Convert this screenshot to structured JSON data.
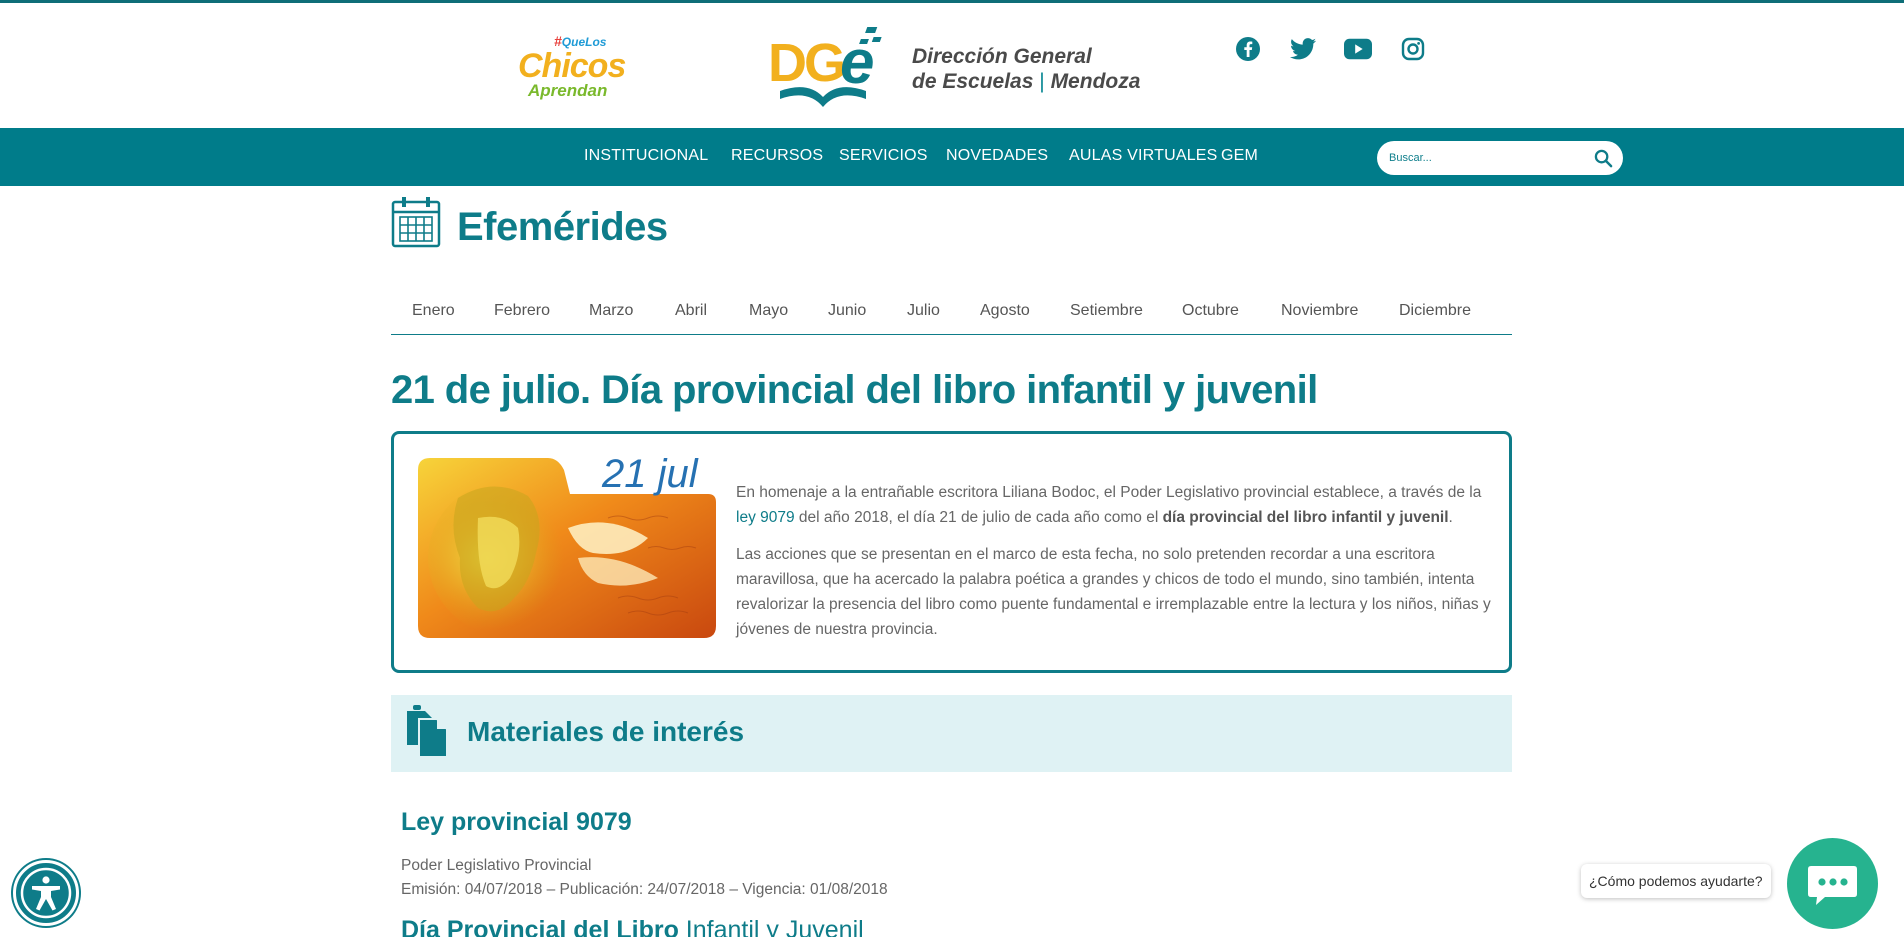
{
  "header": {
    "campaign": {
      "hash": "#",
      "que_los": "QueLos",
      "chicos": "Chicos",
      "aprendan": "Aprendan"
    },
    "logo_mark": "DGe",
    "org_line1": "Dirección General",
    "org_line2a": "de Escuelas",
    "org_sep": "|",
    "org_line2b": "Mendoza",
    "social": [
      "facebook-icon",
      "twitter-icon",
      "youtube-icon",
      "instagram-icon"
    ]
  },
  "nav": {
    "items": [
      "INSTITUCIONAL",
      "RECURSOS",
      "SERVICIOS",
      "NOVEDADES",
      "AULAS VIRTUALES",
      "GEM"
    ],
    "search_placeholder": "Buscar..."
  },
  "page": {
    "title": "Efemérides",
    "months": [
      "Enero",
      "Febrero",
      "Marzo",
      "Abril",
      "Mayo",
      "Junio",
      "Julio",
      "Agosto",
      "Setiembre",
      "Octubre",
      "Noviembre",
      "Diciembre"
    ],
    "headline": "21 de julio. Día provincial del libro infantil y juvenil"
  },
  "card": {
    "date_badge": "21 jul",
    "p1_a": "En homenaje a la entrañable escritora Liliana Bodoc, el Poder Legislativo provincial establece, a través de la ",
    "p1_link": "ley 9079",
    "p1_b": " del año 2018, el día 21 de julio de cada año como el ",
    "p1_bold": "día provincial del libro infantil y juvenil",
    "p1_end": ".",
    "p2": "Las acciones que se presentan en el marco de esta fecha, no solo pretenden recordar a una escritora maravillosa, que ha acercado la palabra poética a grandes y chicos de todo el mundo, sino también, intenta revalorizar la presencia del libro como puente fundamental e irremplazable entre la lectura y los niños, niñas y jóvenes de nuestra provincia."
  },
  "materials": {
    "title": "Materiales de interés",
    "doc1_title": "Ley provincial 9079",
    "doc1_issuer": "Poder Legislativo Provincial",
    "doc1_meta": "Emisión: 04/07/2018  –  Publicación: 24/07/2018  –  Vigencia: 01/08/2018",
    "doc2_title_bold": "Día Provincial del Libro",
    "doc2_title_rest": " Infantil y Juvenil"
  },
  "chat": {
    "prompt": "¿Cómo podemos ayudarte?"
  },
  "colors": {
    "primary": "#007c8a",
    "accent": "#0e7c89",
    "chat": "#26b38f",
    "band": "#dff2f4"
  }
}
